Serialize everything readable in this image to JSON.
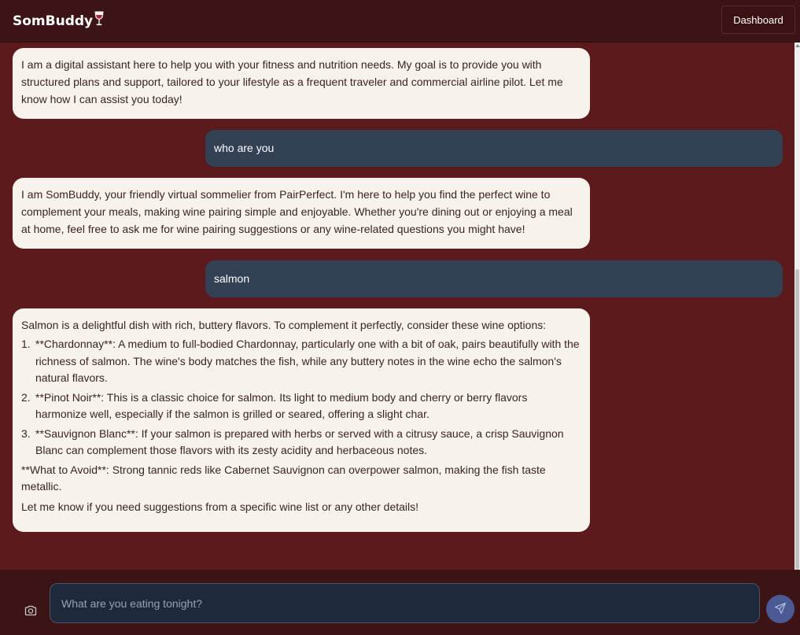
{
  "header": {
    "brand": "SomBuddy",
    "brand_icon": "wine-glass-icon",
    "dashboard_label": "Dashboard"
  },
  "messages": [
    {
      "role": "assistant",
      "text": "I am a digital assistant here to help you with your fitness and nutrition needs. My goal is to provide you with structured plans and support, tailored to your lifestyle as a frequent traveler and commercial airline pilot. Let me know how I can assist you today!"
    },
    {
      "role": "user",
      "text": "who are you"
    },
    {
      "role": "assistant",
      "text": "I am SomBuddy, your friendly virtual sommelier from PairPerfect. I'm here to help you find the perfect wine to complement your meals, making wine pairing simple and enjoyable. Whether you're dining out or enjoying a meal at home, feel free to ask me for wine pairing suggestions or any wine-related questions you might have!"
    },
    {
      "role": "user",
      "text": "salmon"
    },
    {
      "role": "assistant",
      "intro": "Salmon is a delightful dish with rich, buttery flavors. To complement it perfectly, consider these wine options:",
      "items": [
        {
          "num": "1.",
          "text": "**Chardonnay**: A medium to full-bodied Chardonnay, particularly one with a bit of oak, pairs beautifully with the richness of salmon. The wine's body matches the fish, while any buttery notes in the wine echo the salmon's natural flavors."
        },
        {
          "num": "2.",
          "text": "**Pinot Noir**: This is a classic choice for salmon. Its light to medium body and cherry or berry flavors harmonize well, especially if the salmon is grilled or seared, offering a slight char."
        },
        {
          "num": "3.",
          "text": "**Sauvignon Blanc**: If your salmon is prepared with herbs or served with a citrusy sauce, a crisp Sauvignon Blanc can complement those flavors with its zesty acidity and herbaceous notes."
        }
      ],
      "avoid": "**What to Avoid**: Strong tannic reds like Cabernet Sauvignon can overpower salmon, making the fish taste metallic.",
      "closing": "Let me know if you need suggestions from a specific wine list or any other details!"
    }
  ],
  "composer": {
    "placeholder": "What are you eating tonight?",
    "value": "",
    "camera_icon": "camera-icon",
    "send_icon": "send-icon"
  },
  "colors": {
    "background": "#5c1a1c",
    "header": "#3d1416",
    "assistant_bubble": "#f7f3ec",
    "user_bubble": "#334155",
    "input": "#1e293b",
    "send_button": "#4b5a94"
  }
}
